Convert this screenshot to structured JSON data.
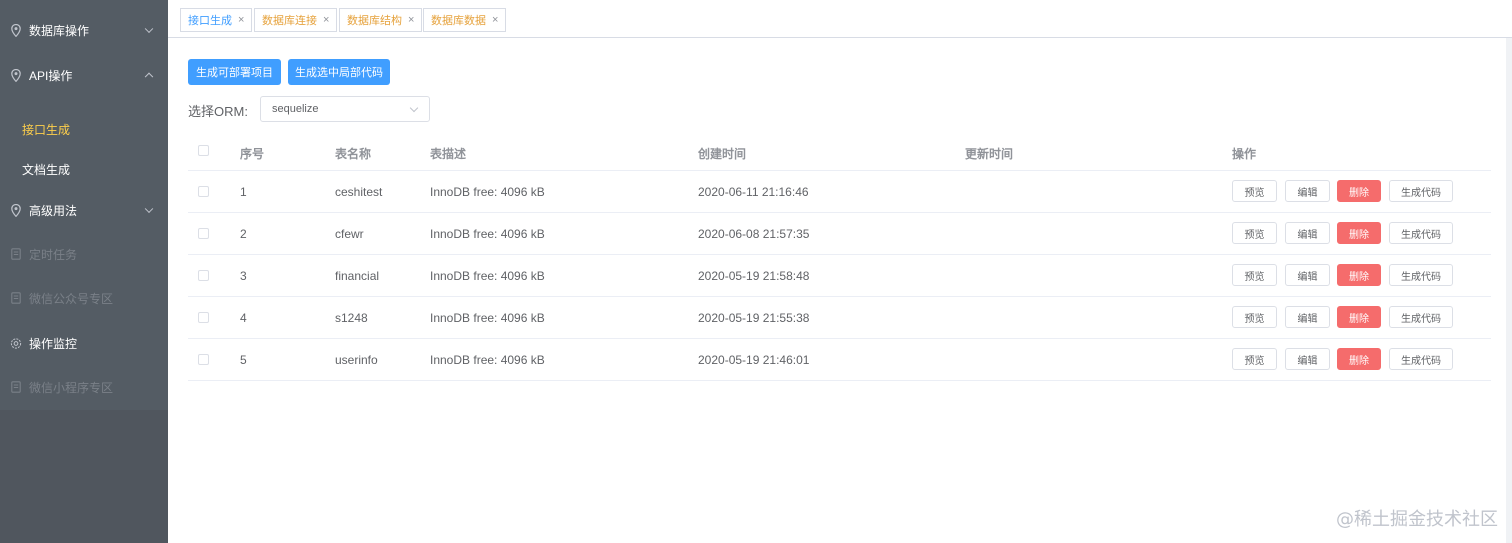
{
  "sidebar": {
    "items": [
      {
        "label": "数据库操作",
        "icon": "location-icon"
      },
      {
        "label": "API操作",
        "icon": "location-icon"
      },
      {
        "label": "高级用法",
        "icon": "location-icon"
      },
      {
        "label": "定时任务",
        "icon": "document-icon"
      },
      {
        "label": "微信公众号专区",
        "icon": "document-icon"
      },
      {
        "label": "操作监控",
        "icon": "gear-icon"
      },
      {
        "label": "微信小程序专区",
        "icon": "document-icon"
      }
    ],
    "sub_items": [
      {
        "label": "接口生成"
      },
      {
        "label": "文档生成"
      }
    ]
  },
  "tabs": [
    {
      "label": "接口生成",
      "close": "×"
    },
    {
      "label": "数据库连接",
      "close": "×"
    },
    {
      "label": "数据库结构",
      "close": "×"
    },
    {
      "label": "数据库数据",
      "close": "×"
    }
  ],
  "toolbar": {
    "generate_project_label": "生成可部署项目",
    "generate_selected_label": "生成选中局部代码"
  },
  "orm": {
    "label": "选择ORM:",
    "selected": "sequelize"
  },
  "table": {
    "headers": {
      "index": "序号",
      "name": "表名称",
      "desc": "表描述",
      "created": "创建时间",
      "updated": "更新时间",
      "ops": "操作"
    },
    "rows": [
      {
        "index": "1",
        "name": "ceshitest",
        "desc": "InnoDB free: 4096 kB",
        "created": "2020-06-11 21:16:46",
        "updated": ""
      },
      {
        "index": "2",
        "name": "cfewr",
        "desc": "InnoDB free: 4096 kB",
        "created": "2020-06-08 21:57:35",
        "updated": ""
      },
      {
        "index": "3",
        "name": "financial",
        "desc": "InnoDB free: 4096 kB",
        "created": "2020-05-19 21:58:48",
        "updated": ""
      },
      {
        "index": "4",
        "name": "s1248",
        "desc": "InnoDB free: 4096 kB",
        "created": "2020-05-19 21:55:38",
        "updated": ""
      },
      {
        "index": "5",
        "name": "userinfo",
        "desc": "InnoDB free: 4096 kB",
        "created": "2020-05-19 21:46:01",
        "updated": ""
      }
    ],
    "ops": {
      "preview": "预览",
      "edit": "编辑",
      "delete": "删除",
      "generate": "生成代码"
    }
  },
  "watermark": "@稀土掘金技术社区",
  "colors": {
    "sidebar_bg": "#545c64",
    "active_menu": "#ffd04b",
    "primary": "#409eff",
    "danger": "#f56c6c",
    "tab_orange": "#e6a23c"
  }
}
